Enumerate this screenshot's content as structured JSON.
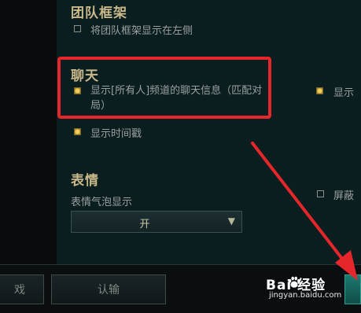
{
  "settings": {
    "team_frame": {
      "heading": "团队框架",
      "option_label": "将团队框架显示在左侧"
    },
    "chat": {
      "heading": "聊天",
      "option_all_label": "显示[所有人]频道的聊天信息（匹配对局）",
      "option_timestamp_label": "显示时间戳",
      "right_partial_label": "显示",
      "right_partial_label2": "屏蔽"
    },
    "emote": {
      "heading": "表情",
      "bubble_label": "表情气泡显示",
      "bubble_value": "开"
    }
  },
  "bottom_bar": {
    "left_button_partial": "戏",
    "surrender_button": "认输"
  },
  "watermark": {
    "brand": "Bai 经验",
    "url": "jingyan.baidu.com"
  },
  "colors": {
    "highlight": "#e5262b",
    "heading": "#c9b98a",
    "checkbox_checked": "#f0cf5a"
  }
}
